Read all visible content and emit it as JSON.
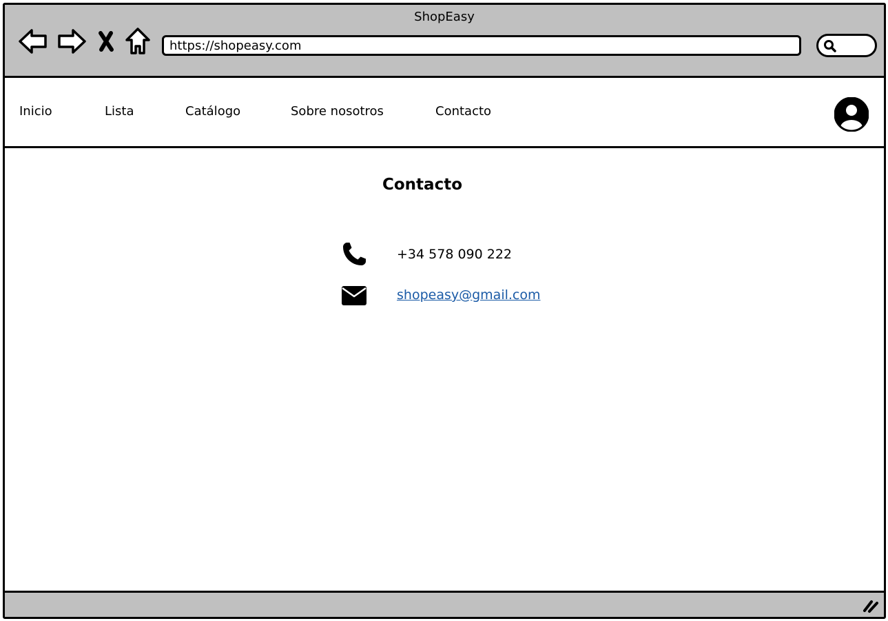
{
  "browser": {
    "window_title": "ShopEasy",
    "url": "https://shopeasy.com",
    "controls": [
      {
        "name": "back-icon"
      },
      {
        "name": "forward-icon"
      },
      {
        "name": "stop-icon"
      },
      {
        "name": "home-icon"
      }
    ],
    "search_icon": "search-icon"
  },
  "nav": {
    "items": [
      {
        "label": "Inicio"
      },
      {
        "label": "Lista"
      },
      {
        "label": "Catálogo"
      },
      {
        "label": "Sobre nosotros"
      },
      {
        "label": "Contacto"
      }
    ],
    "avatar_icon": "user-avatar-icon"
  },
  "main": {
    "title": "Contacto",
    "phone": {
      "icon": "phone-icon",
      "value": "+34 578 090 222"
    },
    "email": {
      "icon": "envelope-icon",
      "value": "shopeasy@gmail.com"
    }
  },
  "colors": {
    "chrome": "#c0c0c0",
    "link": "#1a5aa6",
    "border": "#000000"
  }
}
